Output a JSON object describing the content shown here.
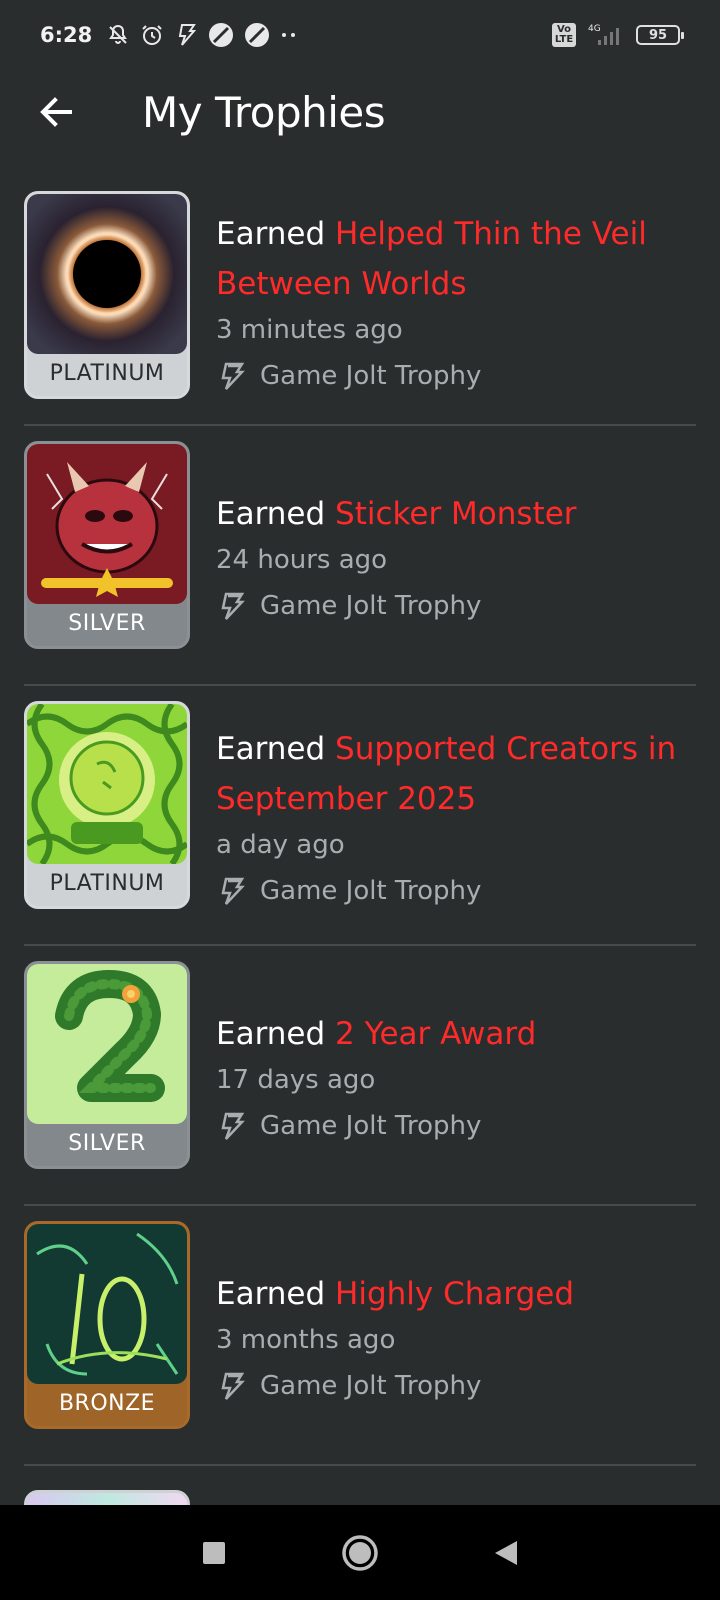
{
  "status_bar": {
    "time": "6:28",
    "network": "4G",
    "volte": "Vo LTE",
    "battery": "95"
  },
  "header": {
    "back_icon": "arrow-left-icon",
    "title": "My Trophies"
  },
  "trophies": [
    {
      "earned_label": "Earned",
      "name": "Helped Thin the Veil Between Worlds",
      "time": "3 minutes ago",
      "tier": "PLATINUM",
      "source": "Game Jolt Trophy",
      "art": "black-hole-image"
    },
    {
      "earned_label": "Earned",
      "name": "Sticker Monster",
      "time": "24 hours ago",
      "tier": "SILVER",
      "source": "Game Jolt Trophy",
      "art": "horned-monster-image"
    },
    {
      "earned_label": "Earned",
      "name": "Supported Creators in September 2025",
      "time": "a day ago",
      "tier": "PLATINUM",
      "source": "Game Jolt Trophy",
      "art": "green-swirl-2025-image"
    },
    {
      "earned_label": "Earned",
      "name": "2 Year Award",
      "time": "17 days ago",
      "tier": "SILVER",
      "source": "Game Jolt Trophy",
      "art": "leafy-number-two-image"
    },
    {
      "earned_label": "Earned",
      "name": "Highly Charged",
      "time": "3 months ago",
      "tier": "BRONZE",
      "source": "Game Jolt Trophy",
      "art": "green-scribble-ten-image"
    }
  ],
  "nav": {
    "recents_icon": "square-icon",
    "home_icon": "circle-icon",
    "back_icon": "triangle-back-icon"
  },
  "colors": {
    "background": "#2a2d2e",
    "trophy_name": "#ff2a2a",
    "muted_text": "#a9adaf",
    "platinum": "#cfd2d4",
    "silver": "#82888c",
    "bronze": "#9e6428"
  }
}
